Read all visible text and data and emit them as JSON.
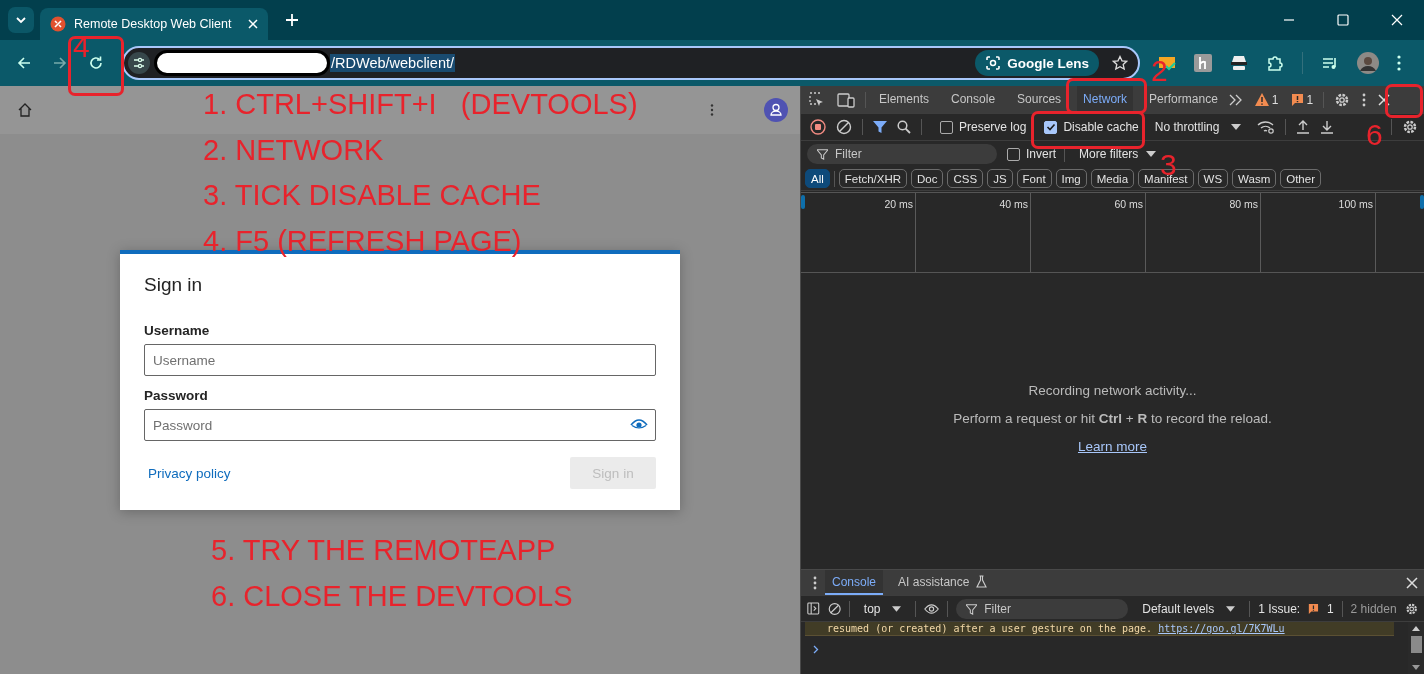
{
  "browser": {
    "tabs": [
      {
        "title": "Remote Desktop Web Client",
        "selected": true
      }
    ],
    "address": {
      "path": "/RDWeb/webclient/"
    },
    "lens_button": "Google Lens"
  },
  "page": {
    "dialog": {
      "title": "Sign in",
      "fields": [
        {
          "label": "Username",
          "placeholder": "Username",
          "kind": "text"
        },
        {
          "label": "Password",
          "placeholder": "Password",
          "kind": "password"
        }
      ],
      "link": "Privacy policy",
      "submit": {
        "label": "Sign in",
        "disabled": true
      }
    }
  },
  "devtools": {
    "tabs": [
      {
        "label": "Elements",
        "selected": false
      },
      {
        "label": "Console",
        "selected": false
      },
      {
        "label": "Sources",
        "selected": false
      },
      {
        "label": "Network",
        "selected": true
      },
      {
        "label": "Performance",
        "selected": false
      }
    ],
    "warnings": "1",
    "issues": "1",
    "options": [
      {
        "label": "Preserve log",
        "checked": false
      },
      {
        "label": "Disable cache",
        "checked": true
      }
    ],
    "throttling": "No throttling",
    "filter": {
      "placeholder": "Filter"
    },
    "invert": {
      "label": "Invert",
      "checked": false
    },
    "more_filters": "More filters",
    "types": [
      {
        "label": "All",
        "selected": true
      },
      {
        "label": "Fetch/XHR",
        "selected": false
      },
      {
        "label": "Doc",
        "selected": false
      },
      {
        "label": "CSS",
        "selected": false
      },
      {
        "label": "JS",
        "selected": false
      },
      {
        "label": "Font",
        "selected": false
      },
      {
        "label": "Img",
        "selected": false
      },
      {
        "label": "Media",
        "selected": false
      },
      {
        "label": "Manifest",
        "selected": false
      },
      {
        "label": "WS",
        "selected": false
      },
      {
        "label": "Wasm",
        "selected": false
      },
      {
        "label": "Other",
        "selected": false
      }
    ],
    "timeline_ticks": [
      "20 ms",
      "40 ms",
      "60 ms",
      "80 ms",
      "100 ms"
    ],
    "empty_state": {
      "title": "Recording network activity...",
      "hint": "Perform a request or hit **Ctrl** + **R** to record the reload.",
      "link": "Learn more"
    },
    "drawer": {
      "tabs": [
        {
          "label": "Console",
          "selected": true
        },
        {
          "label": "AI assistance",
          "selected": false
        }
      ],
      "context": "top",
      "filter": {
        "placeholder": "Filter"
      },
      "levels": "Default levels",
      "issues_label": "1 Issue:",
      "issues_count": "1",
      "hidden": "2 hidden",
      "message": {
        "text": "resumed (or created) after a user gesture on the page.",
        "link": "https://goo.gl/7K7WLu"
      }
    }
  },
  "annotations": {
    "steps": [
      "1. CTRL+SHIFT+I   (DEVTOOLS)",
      "2. NETWORK",
      "3. TICK DISABLE CACHE",
      "4. F5 (REFRESH PAGE)",
      "5. TRY THE REMOTEAPP",
      "6. CLOSE THE DEVTOOLS"
    ],
    "markers": [
      "4",
      "2",
      "6",
      "3"
    ]
  }
}
